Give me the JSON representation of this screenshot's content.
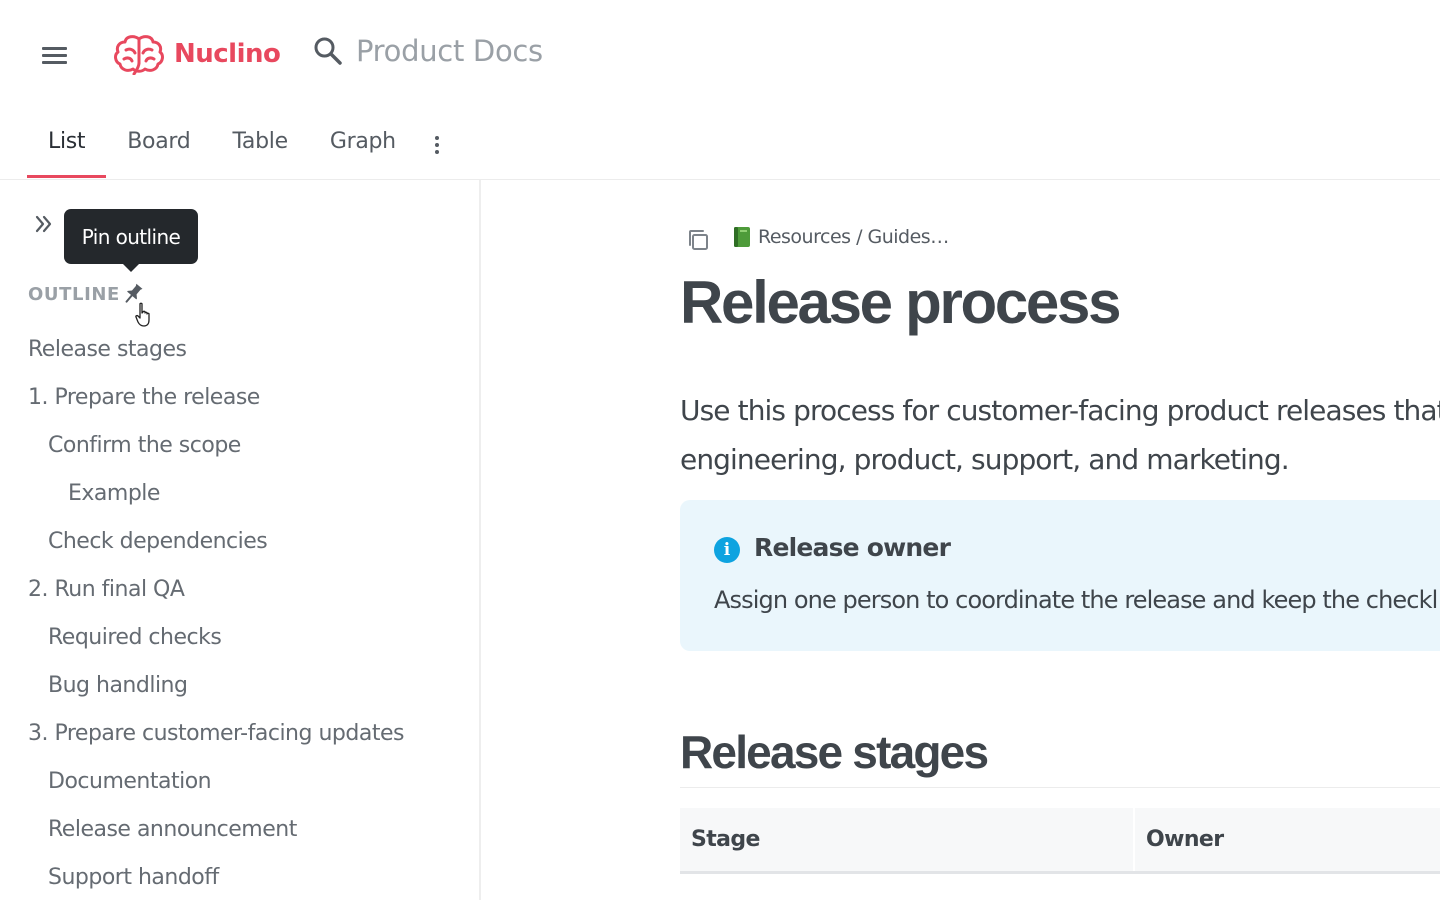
{
  "app": {
    "name": "Nuclino",
    "brand_color": "#e8485e"
  },
  "search": {
    "placeholder": "Product Docs"
  },
  "tabs": [
    {
      "label": "List",
      "active": true
    },
    {
      "label": "Board"
    },
    {
      "label": "Table"
    },
    {
      "label": "Graph"
    }
  ],
  "sidebar": {
    "tooltip": "Pin outline",
    "outline_label": "OUTLINE",
    "items": [
      {
        "label": "Release stages",
        "level": 1
      },
      {
        "label": "1. Prepare the release",
        "level": 1
      },
      {
        "label": "Confirm the scope",
        "level": 2
      },
      {
        "label": "Example",
        "level": 3
      },
      {
        "label": "Check dependencies",
        "level": 2
      },
      {
        "label": "2. Run final QA",
        "level": 1
      },
      {
        "label": "Required checks",
        "level": 2
      },
      {
        "label": "Bug handling",
        "level": 2
      },
      {
        "label": "3. Prepare customer-facing updates",
        "level": 1
      },
      {
        "label": "Documentation",
        "level": 2
      },
      {
        "label": "Release announcement",
        "level": 2
      },
      {
        "label": "Support handoff",
        "level": 2
      }
    ]
  },
  "main": {
    "breadcrumb": "Resources / Guides…",
    "title": "Release process",
    "intro_line1": "Use this process for customer-facing product releases that ir",
    "intro_line2": "engineering, product, support, and marketing.",
    "callout": {
      "title": "Release owner",
      "body": "Assign one person to coordinate the release and keep the checkl",
      "bg_color": "#eaf6fc",
      "icon_color": "#0ea3e0"
    },
    "section_title": "Release stages",
    "table": {
      "headers": [
        "Stage",
        "Owner"
      ]
    }
  }
}
